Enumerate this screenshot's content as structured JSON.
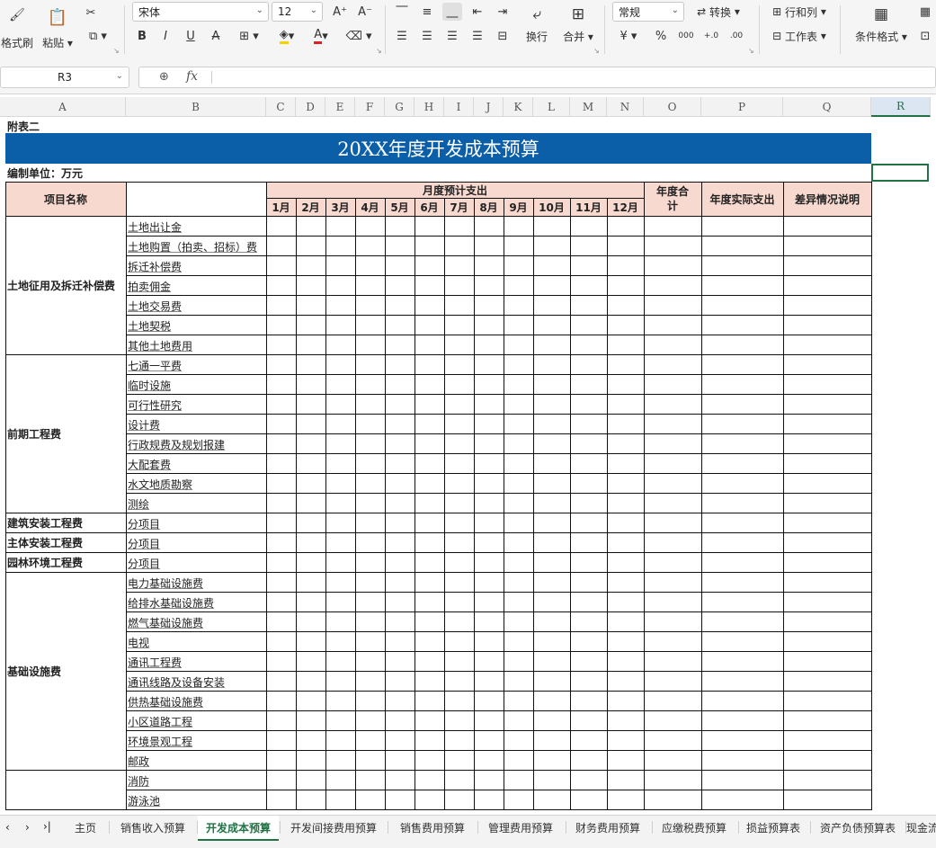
{
  "ribbon": {
    "format_painter": "格式刷",
    "paste": "粘贴",
    "font_name": "宋体",
    "font_size": "12",
    "wrap_text": "换行",
    "merge": "合并",
    "number_format": "常规",
    "convert": "转换",
    "rows_cols": "行和列",
    "worksheet": "工作表",
    "conditional_format": "条件格式",
    "bold": "B",
    "italic": "I",
    "underline": "U",
    "strike": "A",
    "font_color_glyph": "A",
    "currency": "¥",
    "percent": "%",
    "thousands": "000",
    "inc_decimal": "+.0",
    "dec_decimal": ".00"
  },
  "formula_bar": {
    "cell_ref": "R3",
    "fx": "fx",
    "content": ""
  },
  "columns": [
    "A",
    "B",
    "C",
    "D",
    "E",
    "F",
    "G",
    "H",
    "I",
    "J",
    "K",
    "L",
    "M",
    "N",
    "O",
    "P",
    "Q",
    "R"
  ],
  "active_column": "R",
  "sheet": {
    "label_fubiao": "附表二",
    "title": "20XX年度开发成本预算",
    "unit": "编制单位：万元",
    "header_item": "项目名称",
    "header_monthly": "月度预计支出",
    "months": [
      "1月",
      "2月",
      "3月",
      "4月",
      "5月",
      "6月",
      "7月",
      "8月",
      "9月",
      "10月",
      "11月",
      "12月"
    ],
    "header_annual_total": "年度合计",
    "header_actual": "年度实际支出",
    "header_diff": "差异情况说明",
    "groups": [
      {
        "name": "土地征用及拆迁补偿费",
        "items": [
          "土地出让金",
          "土地购置（拍卖、招标）费",
          "拆迁补偿费",
          "拍卖佣金",
          "土地交易费",
          "土地契税",
          "其他土地费用"
        ]
      },
      {
        "name": "前期工程费",
        "items": [
          "七通一平费",
          "临时设施",
          "可行性研究",
          "设计费",
          "行政规费及规划报建",
          "大配套费",
          "水文地质勘察",
          "测绘"
        ]
      },
      {
        "name": "建筑安装工程费",
        "items": [
          "分项目"
        ]
      },
      {
        "name": "主体安装工程费",
        "items": [
          "分项目"
        ]
      },
      {
        "name": "园林环境工程费",
        "items": [
          "分项目"
        ]
      },
      {
        "name": "基础设施费",
        "items": [
          "电力基础设施费",
          "给排水基础设施费",
          "燃气基础设施费",
          "电视",
          "通讯工程费",
          "通讯线路及设备安装",
          "供热基础设施费",
          "小区道路工程",
          "环境景观工程",
          "邮政"
        ]
      },
      {
        "name": "",
        "items": [
          "消防",
          "游泳池"
        ]
      }
    ]
  },
  "tabs": [
    "主页",
    "销售收入预算",
    "开发成本预算",
    "开发间接费用预算",
    "销售费用预算",
    "管理费用预算",
    "财务费用预算",
    "应缴税费预算",
    "损益预算表",
    "资产负债预算表",
    "现金流"
  ],
  "active_tab": "开发成本预算",
  "colors": {
    "title_bg": "#0b5ea8",
    "header_bg": "#f8d9cf",
    "accent": "#217346"
  }
}
